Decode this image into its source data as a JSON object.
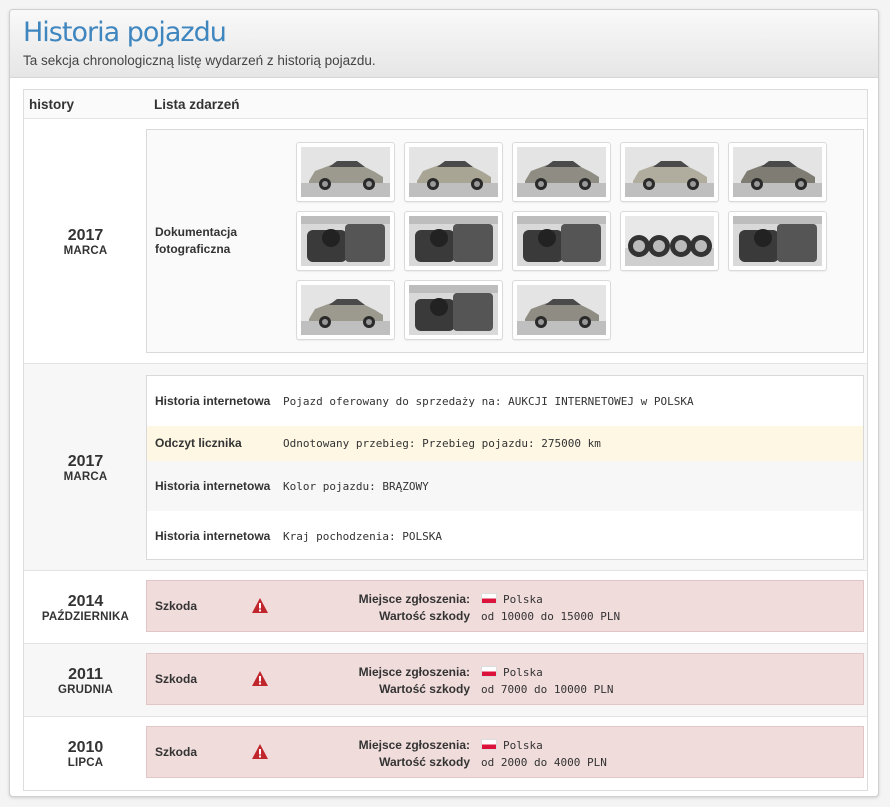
{
  "header": {
    "title": "Historia pojazdu",
    "subtitle": "Ta sekcja chronologiczną listę wydarzeń z historią pojazdu."
  },
  "columns": {
    "history": "history",
    "events": "Lista zdarzeń"
  },
  "photos_entry": {
    "year": "2017",
    "month": "MARCA",
    "label": "Dokumentacja fotograficzna",
    "thumbnails": [
      "car-front-left",
      "car-side-left",
      "car-front",
      "car-side-right",
      "car-rear",
      "interior-door",
      "interior-seats",
      "dashboard",
      "wheels",
      "door-open",
      "car-rear-view",
      "interior-front",
      "car-front-right"
    ]
  },
  "events_entry": {
    "year": "2017",
    "month": "MARCA",
    "events": [
      {
        "label": "Historia internetowa",
        "text": "Pojazd oferowany do sprzedaży na: AUKCJI INTERNETOWEJ w POLSKA"
      },
      {
        "label": "Odczyt licznika",
        "text": "Odnotowany przebieg: Przebieg pojazdu: 275000 km"
      },
      {
        "label": "Historia internetowa",
        "text": "Kolor pojazdu: BRĄZOWY"
      },
      {
        "label": "Historia internetowa",
        "text": "Kraj pochodzenia: POLSKA"
      }
    ]
  },
  "damages": [
    {
      "year": "2014",
      "month": "PAŹDZIERNIKA",
      "label": "Szkoda",
      "place_key": "Miejsce zgłoszenia:",
      "place_value": "Polska",
      "value_key": "Wartość szkody",
      "value_value": "od 10000 do 15000 PLN"
    },
    {
      "year": "2011",
      "month": "GRUDNIA",
      "label": "Szkoda",
      "place_key": "Miejsce zgłoszenia:",
      "place_value": "Polska",
      "value_key": "Wartość szkody",
      "value_value": "od 7000 do 10000 PLN"
    },
    {
      "year": "2010",
      "month": "LIPCA",
      "label": "Szkoda",
      "place_key": "Miejsce zgłoszenia:",
      "place_value": "Polska",
      "value_key": "Wartość szkody",
      "value_value": "od 2000 do 4000 PLN"
    }
  ],
  "colors": {
    "title": "#3f86bf",
    "damage_bg": "#f1dcdc",
    "highlight_bg": "#fdf7e4",
    "warning": "#c0272d"
  }
}
